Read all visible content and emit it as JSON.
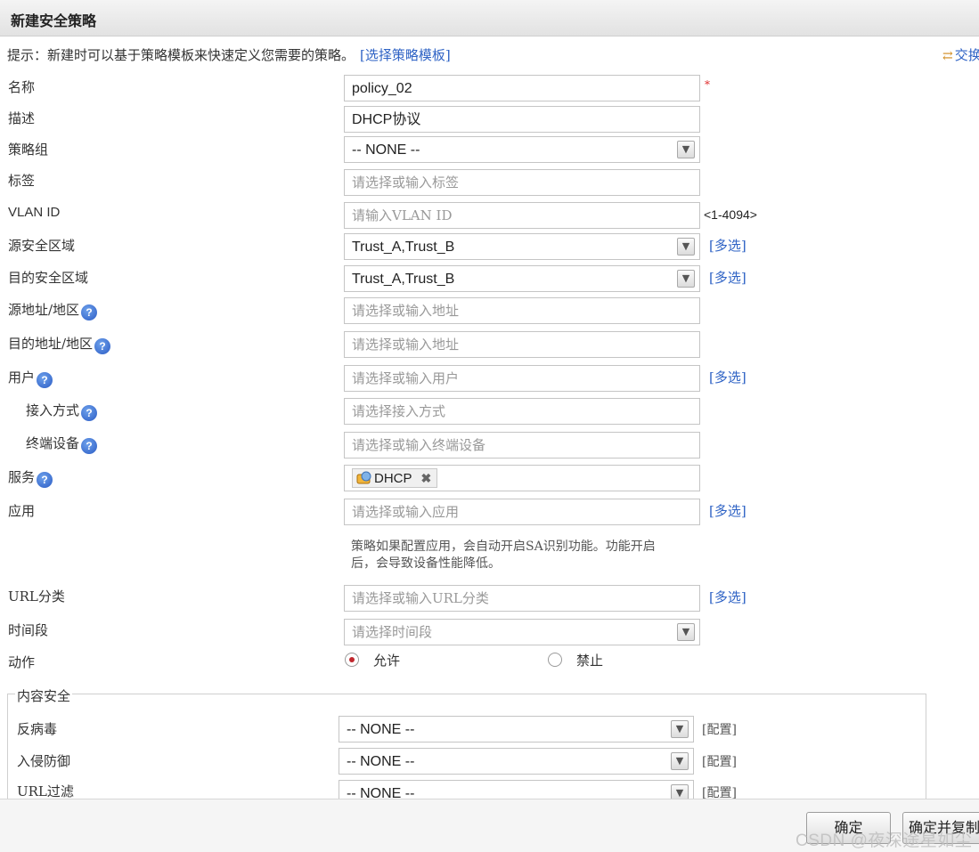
{
  "dialog": {
    "title": "新建安全策略"
  },
  "hint": {
    "text": "提示：新建时可以基于策略模板来快速定义您需要的策略。",
    "link": "[选择策略模板]"
  },
  "swap_link": "交换",
  "required_mark": "*",
  "multi_label": "[多选]",
  "form": {
    "name": {
      "label": "名称",
      "value": "policy_02"
    },
    "description": {
      "label": "描述",
      "value": "DHCP协议"
    },
    "policy_group": {
      "label": "策略组",
      "value": "-- NONE --"
    },
    "tag": {
      "label": "标签",
      "placeholder": "请选择或输入标签"
    },
    "vlan": {
      "label": "VLAN ID",
      "placeholder": "请输入VLAN ID",
      "range": "<1-4094>"
    },
    "src_zone": {
      "label": "源安全区域",
      "value": "Trust_A,Trust_B"
    },
    "dst_zone": {
      "label": "目的安全区域",
      "value": "Trust_A,Trust_B"
    },
    "src_addr": {
      "label": "源地址/地区",
      "placeholder": "请选择或输入地址"
    },
    "dst_addr": {
      "label": "目的地址/地区",
      "placeholder": "请选择或输入地址"
    },
    "user": {
      "label": "用户",
      "placeholder": "请选择或输入用户"
    },
    "access_mode": {
      "label": "接入方式",
      "placeholder": "请选择接入方式"
    },
    "terminal": {
      "label": "终端设备",
      "placeholder": "请选择或输入终端设备"
    },
    "service": {
      "label": "服务",
      "tag": "DHCP"
    },
    "application": {
      "label": "应用",
      "placeholder": "请选择或输入应用",
      "note_line1": "策略如果配置应用，会自动开启SA识别功能。功能开启",
      "note_line2": "后，会导致设备性能降低。"
    },
    "url_category": {
      "label": "URL分类",
      "placeholder": "请选择或输入URL分类"
    },
    "time_range": {
      "label": "时间段",
      "placeholder": "请选择时间段"
    },
    "action": {
      "label": "动作",
      "options": [
        "允许",
        "禁止"
      ],
      "selected": "允许"
    }
  },
  "content_security": {
    "legend": "内容安全",
    "config_label": "[配置]",
    "antivirus": {
      "label": "反病毒",
      "value": "-- NONE --"
    },
    "ips": {
      "label": "入侵防御",
      "value": "-- NONE --"
    },
    "url_filter": {
      "label": "URL过滤",
      "value": "-- NONE --"
    }
  },
  "buttons": {
    "ok": "确定",
    "ok_copy": "确定并复制"
  },
  "watermark": "CSDN @夜深途星如尘"
}
